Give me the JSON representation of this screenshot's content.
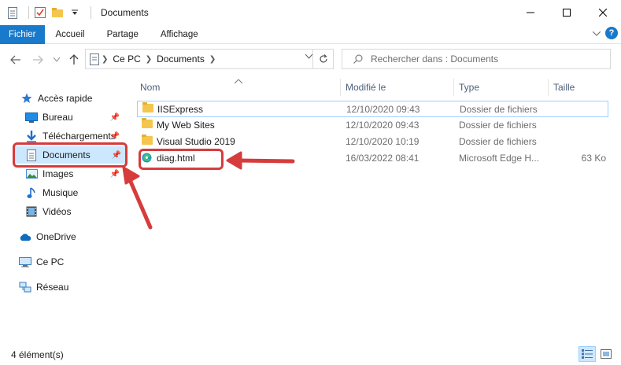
{
  "window": {
    "title": "Documents"
  },
  "ribbon": {
    "tabs": [
      "Fichier",
      "Accueil",
      "Partage",
      "Affichage"
    ]
  },
  "nav": {
    "breadcrumb": [
      "Ce PC",
      "Documents"
    ],
    "search_placeholder": "Rechercher dans : Documents"
  },
  "sidebar": {
    "items": [
      {
        "label": "Accès rapide",
        "icon": "star-icon"
      },
      {
        "label": "Bureau",
        "icon": "desktop-icon",
        "pinned": true
      },
      {
        "label": "Téléchargements",
        "icon": "download-icon",
        "pinned": true
      },
      {
        "label": "Documents",
        "icon": "documents-icon",
        "pinned": true,
        "selected": true
      },
      {
        "label": "Images",
        "icon": "images-icon",
        "pinned": true
      },
      {
        "label": "Musique",
        "icon": "music-icon"
      },
      {
        "label": "Vidéos",
        "icon": "videos-icon"
      },
      {
        "label": "OneDrive",
        "icon": "cloud-icon"
      },
      {
        "label": "Ce PC",
        "icon": "computer-icon"
      },
      {
        "label": "Réseau",
        "icon": "network-icon"
      }
    ]
  },
  "columns": {
    "name": "Nom",
    "date": "Modifié le",
    "type": "Type",
    "size": "Taille"
  },
  "files": [
    {
      "name": "IISExpress",
      "date": "12/10/2020 09:43",
      "type": "Dossier de fichiers",
      "size": "",
      "icon": "folder-icon"
    },
    {
      "name": "My Web Sites",
      "date": "12/10/2020 09:43",
      "type": "Dossier de fichiers",
      "size": "",
      "icon": "folder-icon"
    },
    {
      "name": "Visual Studio 2019",
      "date": "12/10/2020 10:19",
      "type": "Dossier de fichiers",
      "size": "",
      "icon": "folder-icon"
    },
    {
      "name": "diag.html",
      "date": "16/03/2022 08:41",
      "type": "Microsoft Edge H...",
      "size": "63 Ko",
      "icon": "edge-icon"
    }
  ],
  "status": {
    "count": "4 élément(s)"
  },
  "colors": {
    "accent": "#1979ca",
    "annotation": "#d63c3c",
    "selection": "#cce8ff"
  }
}
